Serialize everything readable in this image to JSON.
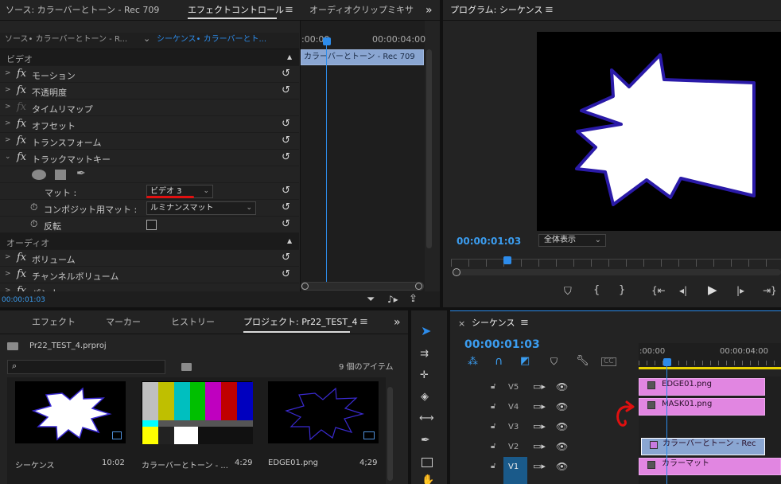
{
  "source_panel": {
    "tab_source": "ソース: カラーバーとトーン - Rec 709",
    "tab_effects": "エフェクトコントロール",
    "tab_mixer": "オーディオクリップミキサ",
    "menu_glyph": "≡",
    "more": "»"
  },
  "effect_controls": {
    "src_left": "ソース• カラーバーとトーン - R...",
    "src_chev": "⌄",
    "src_right": "シーケンス• カラーバーとト...",
    "time_start": ":00:00",
    "time_end": "00:00:04:00",
    "clip_label": "カラーバーとトーン - Rec 709",
    "video_header": "ビデオ",
    "audio_header": "オーディオ",
    "motion": "モーション",
    "opacity": "不透明度",
    "time_remap": "タイムリマップ",
    "offset": "オフセット",
    "transform": "トランスフォーム",
    "track_matte": "トラックマットキー",
    "matte_label": "マット :",
    "matte_value": "ビデオ 3",
    "composite_label": "コンポジット用マット :",
    "composite_value": "ルミナンスマット",
    "reverse_label": "反転",
    "volume": "ボリューム",
    "channel_volume": "チャンネルボリューム",
    "panner": "パンナー",
    "timecode": "00:00:01:03"
  },
  "program": {
    "title": "プログラム: シーケンス",
    "timecode": "00:00:01:03",
    "zoom": "全体表示",
    "zoom_caret": "⌄"
  },
  "project": {
    "tab_effects": "エフェクト",
    "tab_markers": "マーカー",
    "tab_history": "ヒストリー",
    "tab_project": "プロジェクト: Pr22_TEST_4",
    "file": "Pr22_TEST_4.prproj",
    "search_placeholder": "",
    "item_count": "9 個のアイテム",
    "items": [
      {
        "name": "シーケンス",
        "dur": "10:02"
      },
      {
        "name": "カラーバーとトーン - ...",
        "dur": "4:29"
      },
      {
        "name": "EDGE01.png",
        "dur": "4;29"
      }
    ]
  },
  "timeline": {
    "close": "×",
    "title": "シーケンス",
    "timecode": "00:00:01:03",
    "ruler_start": ":00:00",
    "ruler_mid": "00:00:04:00",
    "tracks": [
      {
        "id": "V5",
        "clip": "EDGE01.png"
      },
      {
        "id": "V4",
        "clip": "MASK01.png"
      },
      {
        "id": "V3",
        "clip": ""
      },
      {
        "id": "V2",
        "clip": "カラーバーとトーン - Rec"
      },
      {
        "id": "V1",
        "clip": "カラーマット"
      }
    ]
  },
  "colors": {
    "accent": "#2d8ceb",
    "clip_pink": "#e186e1",
    "clip_blue": "#8aa6d2",
    "annotation_red": "#e01010",
    "timecode_blue": "#3b9df0"
  },
  "icons": [
    "reset-icon",
    "fx-icon",
    "stopwatch-icon",
    "lock-icon",
    "eye-icon",
    "film-icon",
    "play-icon",
    "selection-tool-icon",
    "wrench-icon",
    "filter-icon"
  ]
}
